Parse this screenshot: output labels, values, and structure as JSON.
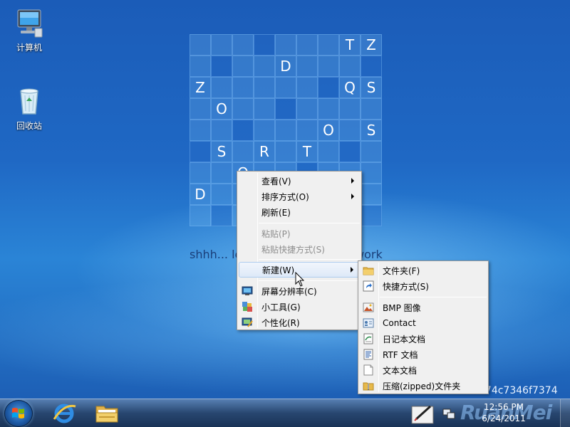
{
  "desktop": {
    "icons": [
      {
        "label": "计算机",
        "icon": "computer-icon"
      },
      {
        "label": "回收站",
        "icon": "recycle-bin-icon"
      }
    ],
    "grid": [
      [
        "",
        "",
        "",
        "",
        "",
        "",
        "",
        "T",
        "Z"
      ],
      [
        "",
        "",
        "",
        "",
        "D",
        "",
        "",
        "",
        ""
      ],
      [
        "Z",
        "",
        "",
        "",
        "",
        "",
        "",
        "Q",
        "S"
      ],
      [
        "",
        "O",
        "",
        "",
        "",
        "",
        "",
        "",
        ""
      ],
      [
        "",
        "",
        "",
        "",
        "",
        "",
        "O",
        "",
        "S"
      ],
      [
        "",
        "S",
        "",
        "R",
        "",
        "T",
        "",
        "",
        ""
      ],
      [
        "",
        "",
        "O",
        "",
        "",
        "",
        "",
        "",
        ""
      ],
      [
        "D",
        "",
        "",
        "",
        "",
        "",
        "",
        "",
        ""
      ],
      [
        "",
        "",
        "",
        "",
        "",
        "",
        "",
        "",
        ""
      ]
    ],
    "caption_left": "shhh... le",
    "caption_right": "work",
    "hash_text": "974c7346f7374"
  },
  "context_menu": {
    "items": [
      {
        "label": "查看(V)",
        "submenu": true
      },
      {
        "label": "排序方式(O)",
        "submenu": true
      },
      {
        "label": "刷新(E)"
      },
      {
        "label": "粘贴(P)",
        "disabled": true
      },
      {
        "label": "粘贴快捷方式(S)",
        "disabled": true
      },
      {
        "label": "新建(W)",
        "submenu": true,
        "highlighted": true
      },
      {
        "label": "屏幕分辨率(C)",
        "icon": "screen-resolution-icon"
      },
      {
        "label": "小工具(G)",
        "icon": "gadgets-icon"
      },
      {
        "label": "个性化(R)",
        "icon": "personalize-icon"
      }
    ]
  },
  "new_submenu": {
    "items": [
      {
        "label": "文件夹(F)",
        "icon": "folder-icon"
      },
      {
        "label": "快捷方式(S)",
        "icon": "shortcut-icon"
      },
      {
        "label": "BMP 图像",
        "icon": "bmp-image-icon"
      },
      {
        "label": "Contact",
        "icon": "contact-icon"
      },
      {
        "label": "日记本文档",
        "icon": "journal-icon"
      },
      {
        "label": "RTF 文档",
        "icon": "rtf-document-icon"
      },
      {
        "label": "文本文档",
        "icon": "text-document-icon"
      },
      {
        "label": "压缩(zipped)文件夹",
        "icon": "zip-folder-icon"
      }
    ]
  },
  "taskbar": {
    "start_icon": "windows-start-icon",
    "pinned": [
      "internet-explorer-icon",
      "file-explorer-icon"
    ],
    "tray_icons": [
      "pen-input-icon",
      "network-icon"
    ],
    "clock_time": "12:56 PM",
    "clock_date": "6/24/2011",
    "watermark": "RuanMei"
  }
}
